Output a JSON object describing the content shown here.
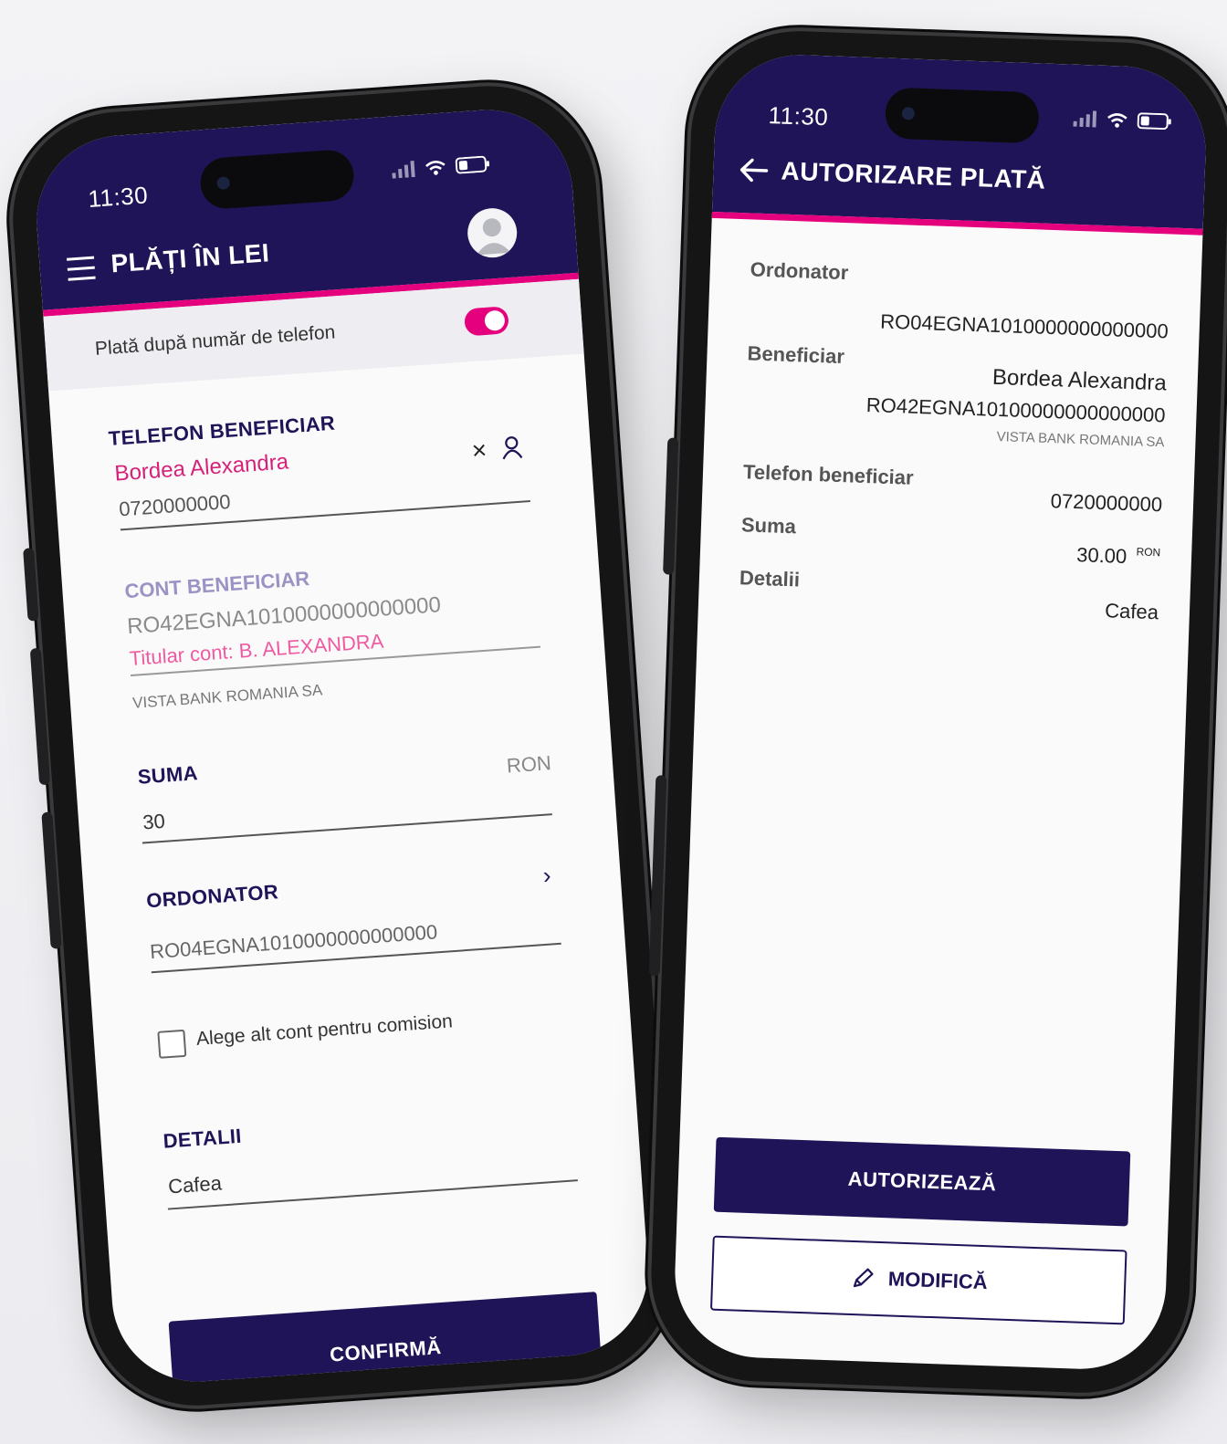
{
  "status": {
    "time": "11:30"
  },
  "left": {
    "title": "PLĂȚI ÎN LEI",
    "toggle_label": "Plată după număr de telefon",
    "telefon": {
      "label": "TELEFON BENEFICIAR",
      "name": "Bordea Alexandra",
      "number": "0720000000",
      "clear": "×"
    },
    "cont": {
      "label": "CONT BENEFICIAR",
      "iban": "RO42EGNA1010000000000000",
      "holder": "Titular cont: B. ALEXANDRA",
      "bank": "VISTA BANK ROMANIA SA"
    },
    "suma": {
      "label": "SUMA",
      "value": "30",
      "currency": "RON"
    },
    "ordonator": {
      "label": "ORDONATOR",
      "iban": "RO04EGNA1010000000000000",
      "chevron": "›"
    },
    "comision_label": "Alege alt cont pentru comision",
    "detalii": {
      "label": "DETALII",
      "value": "Cafea"
    },
    "confirm_label": "CONFIRMĂ"
  },
  "right": {
    "title": "AUTORIZARE PLATĂ",
    "ordonator": {
      "label": "Ordonator",
      "iban": "RO04EGNA1010000000000000"
    },
    "beneficiar": {
      "label": "Beneficiar",
      "name": "Bordea Alexandra",
      "iban": "RO42EGNA10100000000000000",
      "bank": "VISTA BANK ROMANIA SA"
    },
    "telefon": {
      "label": "Telefon beneficiar",
      "value": "0720000000"
    },
    "suma": {
      "label": "Suma",
      "value": "30.00",
      "currency": "RON"
    },
    "detalii": {
      "label": "Detalii",
      "value": "Cafea"
    },
    "authorize_label": "AUTORIZEAZĂ",
    "modify_label": "MODIFICĂ"
  },
  "colors": {
    "navy": "#1f1457",
    "pink": "#e5007e",
    "holder_pink": "#ee5ba2"
  }
}
